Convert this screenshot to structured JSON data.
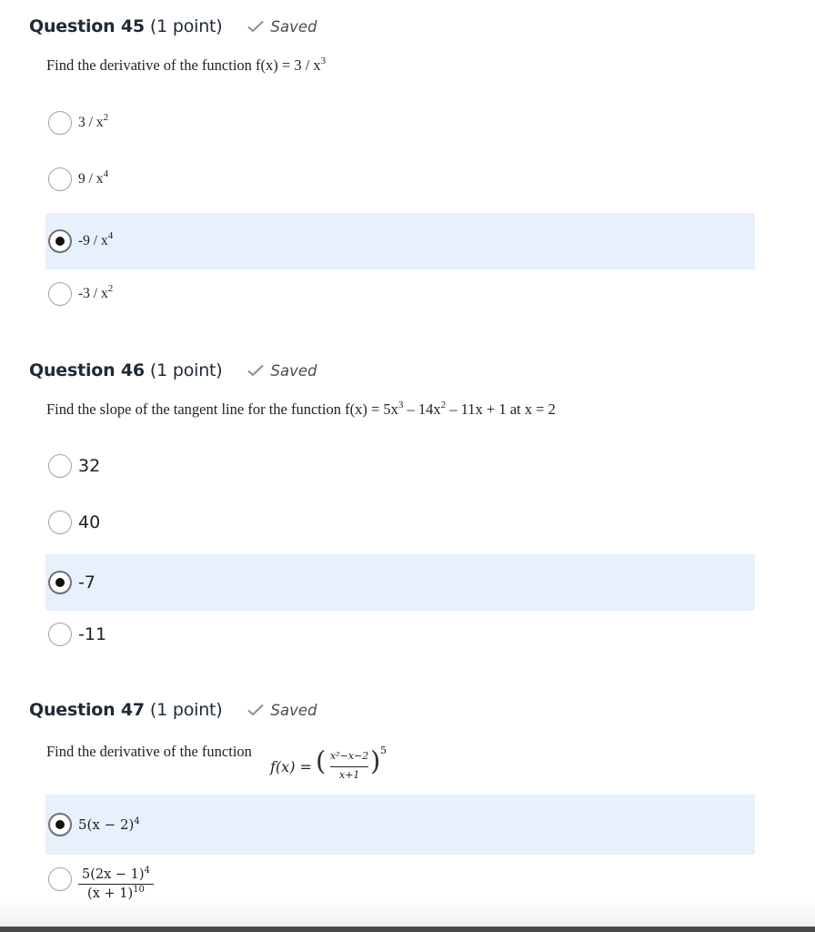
{
  "saved_label": "Saved",
  "q45": {
    "title": "Question 45",
    "points": "(1 point)",
    "prompt_text": "Find the derivative of the function f(x) = 3 / x",
    "prompt_exp": "3",
    "options": [
      {
        "base": "3 / x",
        "exp": "2",
        "selected": false
      },
      {
        "base": "9 / x",
        "exp": "4",
        "selected": false
      },
      {
        "base": "-9 / x",
        "exp": "4",
        "selected": true
      },
      {
        "base": "-3 / x",
        "exp": "2",
        "selected": false
      }
    ]
  },
  "q46": {
    "title": "Question 46",
    "points": "(1 point)",
    "prompt_a": "Find the slope of the tangent line for the function f(x) = 5x",
    "prompt_exp1": "3",
    "prompt_b": " – 14x",
    "prompt_exp2": "2",
    "prompt_c": " – 11x + 1 at x = 2",
    "options": [
      {
        "label": "32",
        "selected": false
      },
      {
        "label": "40",
        "selected": false
      },
      {
        "label": "-7",
        "selected": true
      },
      {
        "label": "-11",
        "selected": false
      }
    ]
  },
  "q47": {
    "title": "Question 47",
    "points": "(1 point)",
    "prompt_text": "Find the derivative of the function",
    "fn_lhs": "f(x) =",
    "fn_num": "x²−x−2",
    "fn_den": "x+1",
    "fn_pow": "5",
    "options": [
      {
        "text": "5(x − 2)",
        "exp": "4",
        "selected": true
      },
      {
        "num": "5(2x − 1)",
        "num_exp": "4",
        "den": "(x + 1)",
        "den_exp": "10",
        "selected": false
      }
    ]
  }
}
